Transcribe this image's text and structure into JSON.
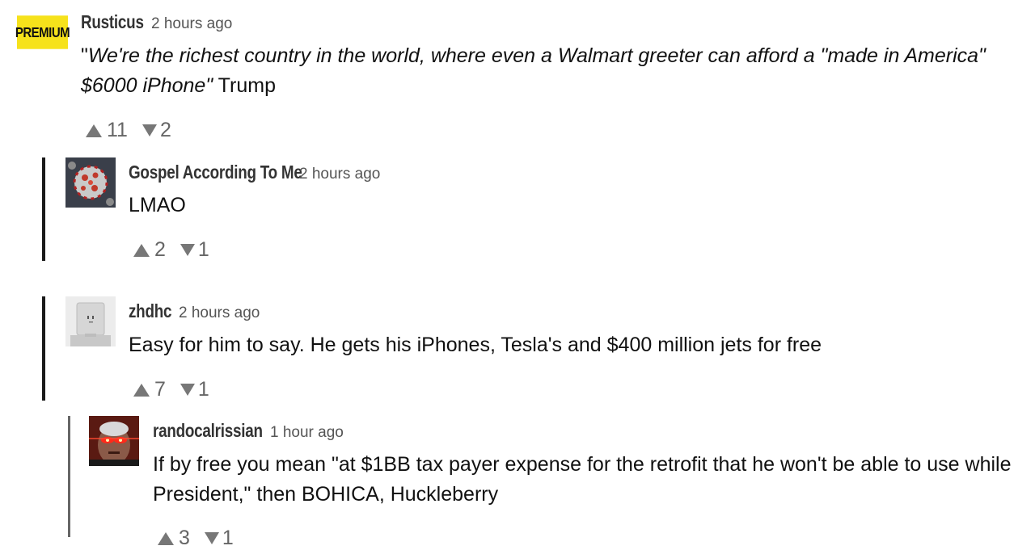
{
  "comments": [
    {
      "username": "Rusticus",
      "timestamp": "2 hours ago",
      "badge": "PREMIUM",
      "body_open_quote": "\"",
      "body_italic": "We're the richest country in the world,  where even a Walmart greeter can afford a \"made in America\"",
      "body_italic_line2": "$6000 iPhone\"",
      "body_tail": " Trump",
      "upvotes": "11",
      "downvotes": "2"
    },
    {
      "username": "Gospel According To Me",
      "timestamp": "2 hours ago",
      "avatar": "virus-avatar",
      "body": "LMAO",
      "upvotes": "2",
      "downvotes": "1"
    },
    {
      "username": "zhdhc",
      "timestamp": "2 hours ago",
      "avatar": "robot-avatar",
      "body": "Easy for him to say. He gets his iPhones, Tesla's  and $400 million jets for free",
      "upvotes": "7",
      "downvotes": "1"
    },
    {
      "username": "randocalrissian",
      "timestamp": "1 hour ago",
      "avatar": "laser-eyes-avatar",
      "body_line1": "If by free you mean \"at $1BB tax payer expense for the retrofit that he won't be able to use while",
      "body_line2": "President,\" then BOHICA, Huckleberry",
      "upvotes": "3",
      "downvotes": "1"
    }
  ],
  "colors": {
    "premium_badge": "#f6e21b",
    "thread_bar": "#1a1a1a",
    "vote_icon": "#777777"
  }
}
